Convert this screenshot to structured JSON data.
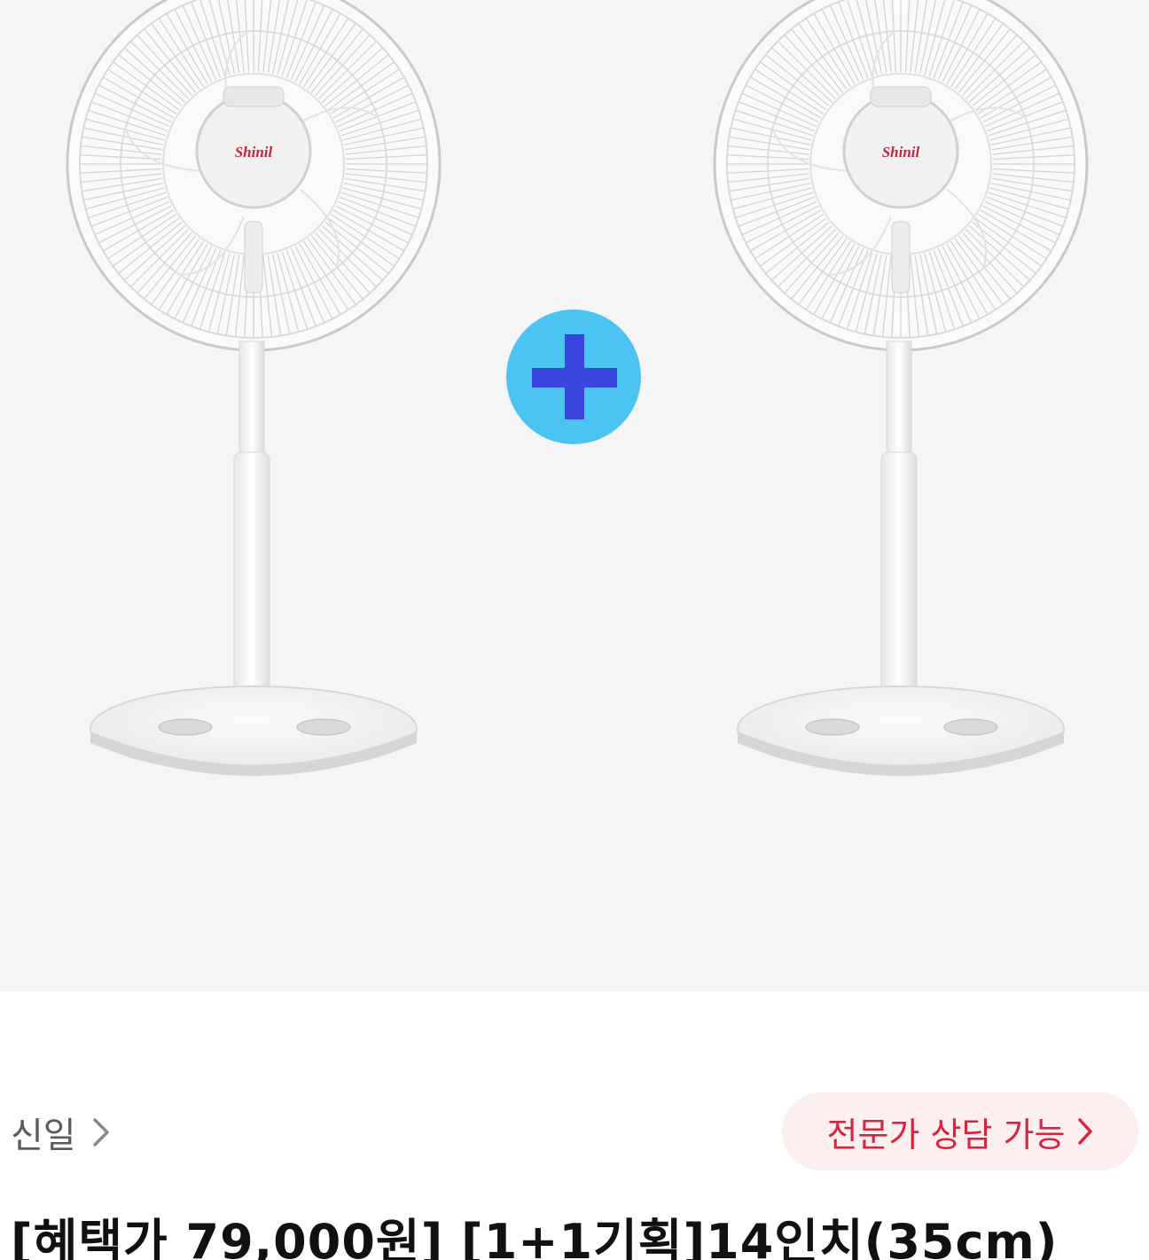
{
  "product": {
    "image_logo_text": "Shinil",
    "brand": "신일",
    "brand_chevron_icon": "chevron-right-icon",
    "consult_label": "전문가 상담 가능",
    "consult_chevron_icon": "chevron-right-icon",
    "title": "[혜택가 79,000원] [1+1기획]14인치(35cm)"
  },
  "colors": {
    "background": "#f5f5f5",
    "consult_bg": "#fdeef0",
    "consult_text": "#d8243f",
    "plus_badge": "#4cc4f2",
    "plus_sign": "#3a45e0"
  },
  "icons": {
    "plus": "plus-icon"
  }
}
